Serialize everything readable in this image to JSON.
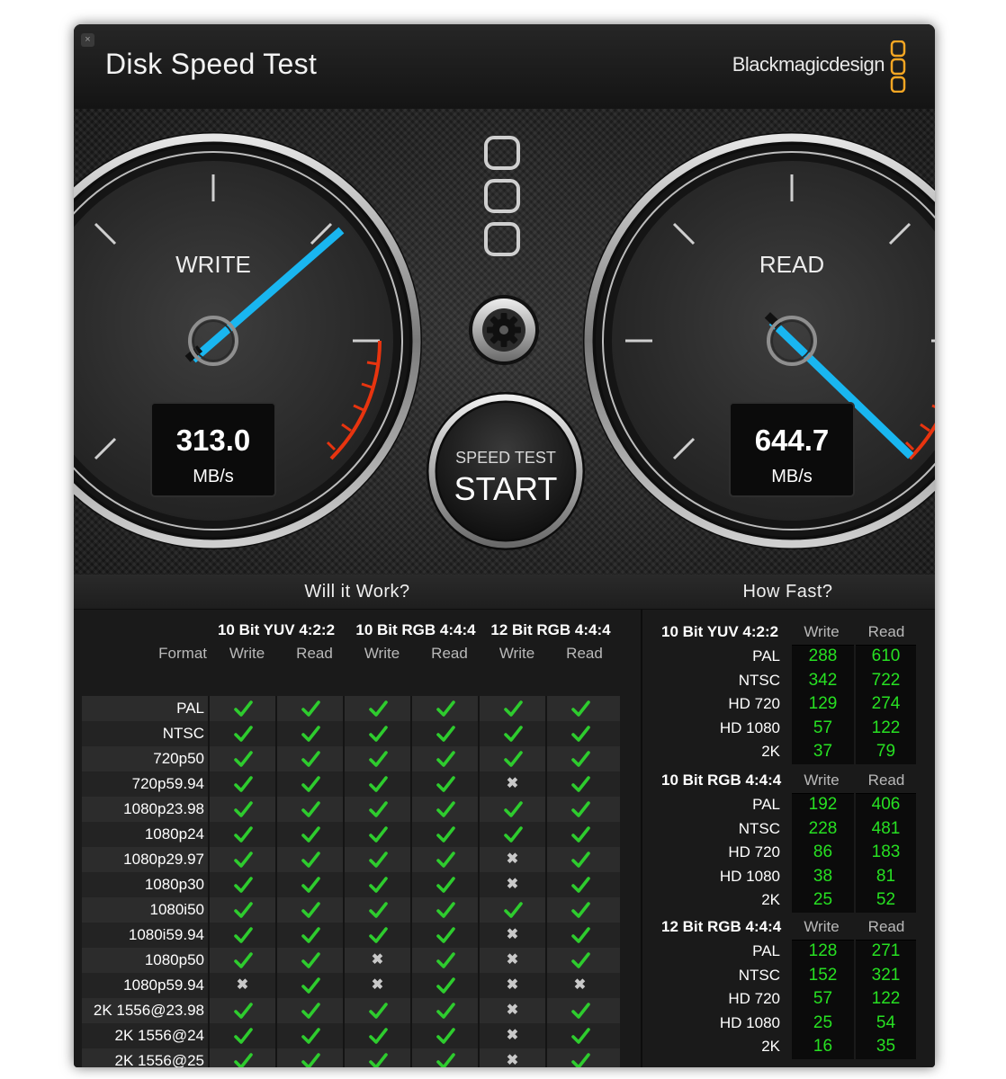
{
  "window": {
    "title": "Disk Speed Test",
    "close_glyph": "×",
    "brand": "Blackmagicdesign",
    "brand_color": "#f5a623"
  },
  "gauges": {
    "write": {
      "label": "WRITE",
      "value": "313.0",
      "unit": "MB/s",
      "needle_color": "#19b6f0"
    },
    "read": {
      "label": "READ",
      "value": "644.7",
      "unit": "MB/s",
      "needle_color": "#19b6f0"
    },
    "redline_color": "#e8340f"
  },
  "controls": {
    "settings_icon": "gear-icon",
    "start_small": "SPEED TEST",
    "start_big": "START"
  },
  "will_it_work": {
    "title": "Will it Work?",
    "format_header": "Format",
    "groups": [
      "10 Bit YUV 4:2:2",
      "10 Bit RGB 4:4:4",
      "12 Bit RGB 4:4:4"
    ],
    "sub_headers": [
      "Write",
      "Read",
      "Write",
      "Read",
      "Write",
      "Read"
    ],
    "rows": [
      {
        "format": "PAL",
        "cells": [
          1,
          1,
          1,
          1,
          1,
          1
        ]
      },
      {
        "format": "NTSC",
        "cells": [
          1,
          1,
          1,
          1,
          1,
          1
        ]
      },
      {
        "format": "720p50",
        "cells": [
          1,
          1,
          1,
          1,
          1,
          1
        ]
      },
      {
        "format": "720p59.94",
        "cells": [
          1,
          1,
          1,
          1,
          0,
          1
        ]
      },
      {
        "format": "1080p23.98",
        "cells": [
          1,
          1,
          1,
          1,
          1,
          1
        ]
      },
      {
        "format": "1080p24",
        "cells": [
          1,
          1,
          1,
          1,
          1,
          1
        ]
      },
      {
        "format": "1080p29.97",
        "cells": [
          1,
          1,
          1,
          1,
          0,
          1
        ]
      },
      {
        "format": "1080p30",
        "cells": [
          1,
          1,
          1,
          1,
          0,
          1
        ]
      },
      {
        "format": "1080i50",
        "cells": [
          1,
          1,
          1,
          1,
          1,
          1
        ]
      },
      {
        "format": "1080i59.94",
        "cells": [
          1,
          1,
          1,
          1,
          0,
          1
        ]
      },
      {
        "format": "1080p50",
        "cells": [
          1,
          1,
          0,
          1,
          0,
          1
        ]
      },
      {
        "format": "1080p59.94",
        "cells": [
          0,
          1,
          0,
          1,
          0,
          0
        ]
      },
      {
        "format": "2K 1556@23.98",
        "cells": [
          1,
          1,
          1,
          1,
          0,
          1
        ]
      },
      {
        "format": "2K 1556@24",
        "cells": [
          1,
          1,
          1,
          1,
          0,
          1
        ]
      },
      {
        "format": "2K 1556@25",
        "cells": [
          1,
          1,
          1,
          1,
          0,
          1
        ]
      }
    ],
    "ok_color": "#2ecc2e",
    "no_glyph": "✖"
  },
  "how_fast": {
    "title": "How Fast?",
    "write_header": "Write",
    "read_header": "Read",
    "value_color": "#27e022",
    "groups": [
      {
        "name": "10 Bit YUV 4:2:2",
        "rows": [
          {
            "format": "PAL",
            "write": "288",
            "read": "610"
          },
          {
            "format": "NTSC",
            "write": "342",
            "read": "722"
          },
          {
            "format": "HD 720",
            "write": "129",
            "read": "274"
          },
          {
            "format": "HD 1080",
            "write": "57",
            "read": "122"
          },
          {
            "format": "2K",
            "write": "37",
            "read": "79"
          }
        ]
      },
      {
        "name": "10 Bit RGB 4:4:4",
        "rows": [
          {
            "format": "PAL",
            "write": "192",
            "read": "406"
          },
          {
            "format": "NTSC",
            "write": "228",
            "read": "481"
          },
          {
            "format": "HD 720",
            "write": "86",
            "read": "183"
          },
          {
            "format": "HD 1080",
            "write": "38",
            "read": "81"
          },
          {
            "format": "2K",
            "write": "25",
            "read": "52"
          }
        ]
      },
      {
        "name": "12 Bit RGB 4:4:4",
        "rows": [
          {
            "format": "PAL",
            "write": "128",
            "read": "271"
          },
          {
            "format": "NTSC",
            "write": "152",
            "read": "321"
          },
          {
            "format": "HD 720",
            "write": "57",
            "read": "122"
          },
          {
            "format": "HD 1080",
            "write": "25",
            "read": "54"
          },
          {
            "format": "2K",
            "write": "16",
            "read": "35"
          }
        ]
      }
    ]
  }
}
